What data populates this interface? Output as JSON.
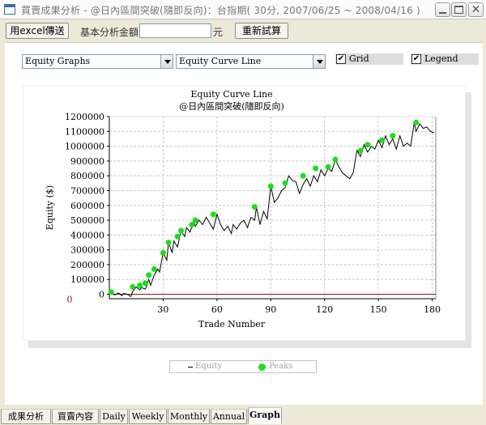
{
  "window": {
    "title": "買賣成果分析 - @日內區間突破(隨即反向)：台指期( 30分, 2007/06/25 ~ 2008/04/16 )",
    "close_glyph": "✕"
  },
  "toolbar": {
    "export_label": "用excel傳送",
    "amount_label": "基本分析金額",
    "amount_value": "",
    "unit_label": "元",
    "calc_label": "重新試算"
  },
  "controls": {
    "graph_select": "Equity Graphs",
    "curve_select": "Equity Curve Line",
    "grid_label": "Grid",
    "grid_checked": true,
    "legend_label": "Legend",
    "legend_checked": true,
    "check_mark": "✔"
  },
  "legend": {
    "equity_label": "Equity",
    "peaks_label": "Peaks"
  },
  "tabs": [
    {
      "label": "成果分析",
      "active": false
    },
    {
      "label": "買賣內容",
      "active": false
    },
    {
      "label": "Daily",
      "active": false
    },
    {
      "label": "Weekly",
      "active": false
    },
    {
      "label": "Monthly",
      "active": false
    },
    {
      "label": "Annual",
      "active": false
    },
    {
      "label": "Graph",
      "active": true
    }
  ],
  "colors": {
    "line": "#000000",
    "peak": "#19e019",
    "zero_line": "#8b1a1a",
    "grid": "#c8c8c8"
  },
  "chart_data": {
    "type": "line",
    "title": "Equity Curve Line",
    "subtitle": "@日內區間突破(隨即反向)",
    "xlabel": "Trade Number",
    "ylabel": "Equity ($)",
    "xlim": [
      0,
      182
    ],
    "ylim": [
      -30000,
      1200000
    ],
    "xticks": [
      30,
      60,
      90,
      120,
      150,
      180
    ],
    "yticks": [
      0,
      100000,
      200000,
      300000,
      400000,
      500000,
      600000,
      700000,
      800000,
      900000,
      1000000,
      1100000,
      1200000
    ],
    "zero_label": "0",
    "grid": true,
    "series": [
      {
        "name": "Equity",
        "x": [
          1,
          3,
          5,
          7,
          8,
          10,
          12,
          13,
          15,
          17,
          18,
          20,
          21,
          22,
          23,
          25,
          27,
          28,
          30,
          32,
          33,
          35,
          36,
          38,
          40,
          42,
          43,
          45,
          47,
          48,
          50,
          52,
          54,
          56,
          58,
          60,
          62,
          64,
          66,
          68,
          69,
          71,
          73,
          75,
          77,
          79,
          81,
          82,
          84,
          86,
          88,
          90,
          92,
          94,
          96,
          98,
          100,
          102,
          104,
          106,
          108,
          110,
          112,
          114,
          116,
          118,
          120,
          122,
          124,
          126,
          128,
          130,
          132,
          134,
          136,
          138,
          140,
          142,
          144,
          146,
          148,
          150,
          152,
          154,
          156,
          158,
          160,
          162,
          164,
          166,
          168,
          170,
          171,
          173,
          175,
          177,
          179,
          181
        ],
        "y": [
          15000,
          -5000,
          10000,
          -10000,
          5000,
          0,
          -15000,
          20000,
          50000,
          30000,
          45000,
          35000,
          60000,
          100000,
          60000,
          130000,
          170000,
          150000,
          280000,
          230000,
          350000,
          280000,
          360000,
          320000,
          430000,
          390000,
          450000,
          420000,
          490000,
          460000,
          500000,
          470000,
          520000,
          480000,
          440000,
          540000,
          470000,
          430000,
          460000,
          410000,
          470000,
          440000,
          480000,
          500000,
          450000,
          520000,
          500000,
          590000,
          470000,
          560000,
          510000,
          730000,
          620000,
          650000,
          700000,
          720000,
          800000,
          770000,
          760000,
          680000,
          740000,
          780000,
          730000,
          800000,
          760000,
          840000,
          800000,
          850000,
          830000,
          910000,
          860000,
          820000,
          800000,
          780000,
          820000,
          970000,
          930000,
          1010000,
          960000,
          1000000,
          980000,
          1040000,
          990000,
          1070000,
          1010000,
          1050000,
          980000,
          1070000,
          1000000,
          1020000,
          1000000,
          1160000,
          1100000,
          1150000,
          1120000,
          1130000,
          1100000,
          1090000
        ]
      },
      {
        "name": "Peaks",
        "x": [
          1,
          13,
          17,
          20,
          22,
          25,
          30,
          33,
          38,
          40,
          46,
          48,
          58,
          81,
          90,
          98,
          108,
          115,
          122,
          126,
          140,
          144,
          152,
          158,
          171
        ],
        "y": [
          15000,
          50000,
          60000,
          75000,
          130000,
          170000,
          280000,
          350000,
          390000,
          430000,
          470000,
          500000,
          540000,
          590000,
          730000,
          750000,
          800000,
          850000,
          860000,
          910000,
          970000,
          1010000,
          1040000,
          1070000,
          1160000
        ]
      }
    ]
  }
}
